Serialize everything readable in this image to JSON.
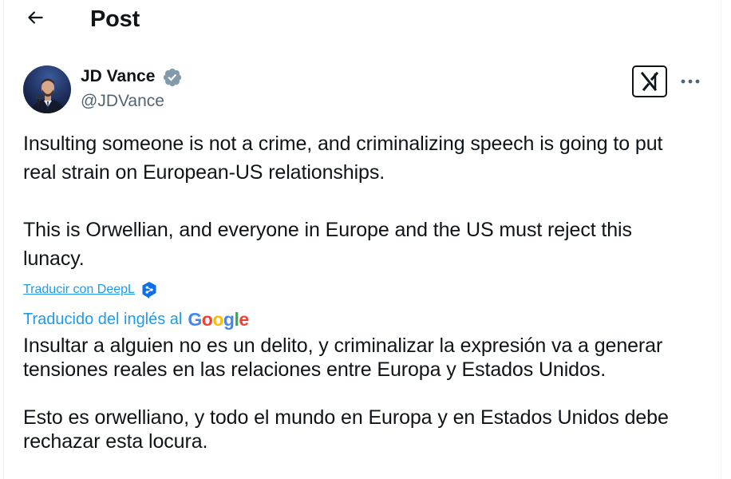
{
  "header": {
    "title": "Post",
    "back_icon": "arrow-left-icon"
  },
  "author": {
    "name": "JD Vance",
    "handle": "@JDVance",
    "verified_color": "#829aab",
    "verified_icon": "verified-badge-icon"
  },
  "actions": {
    "grok_icon": "grok-icon",
    "more_icon": "more-horizontal-icon"
  },
  "tweet": {
    "text": "Insulting someone is not a crime, and criminalizing speech is going to put\nreal strain on European-US relationships.\n\nThis is Orwellian, and everyone in Europe and the US must reject this\nlunacy."
  },
  "translation": {
    "deepl_link": "Traducir con DeepL",
    "deepl_icon": "deepl-logo-icon",
    "translated_label": "Traducido del inglés al",
    "google_logo": [
      "G",
      "o",
      "o",
      "g",
      "l",
      "e"
    ],
    "google_colors": [
      "#4285F4",
      "#EA4335",
      "#FBBC05",
      "#4285F4",
      "#34A853",
      "#EA4335"
    ],
    "text": "Insultar a alguien no es un delito, y criminalizar la expresión va a generar\ntensiones reales en las relaciones entre Europa y Estados Unidos.\n\nEsto es orwelliano, y todo el mundo en Europa y en Estados Unidos debe\nrechazar esta locura."
  },
  "colors": {
    "link": "#1d9bf0",
    "secondary_text": "#536471",
    "primary_text": "#0f1419"
  }
}
